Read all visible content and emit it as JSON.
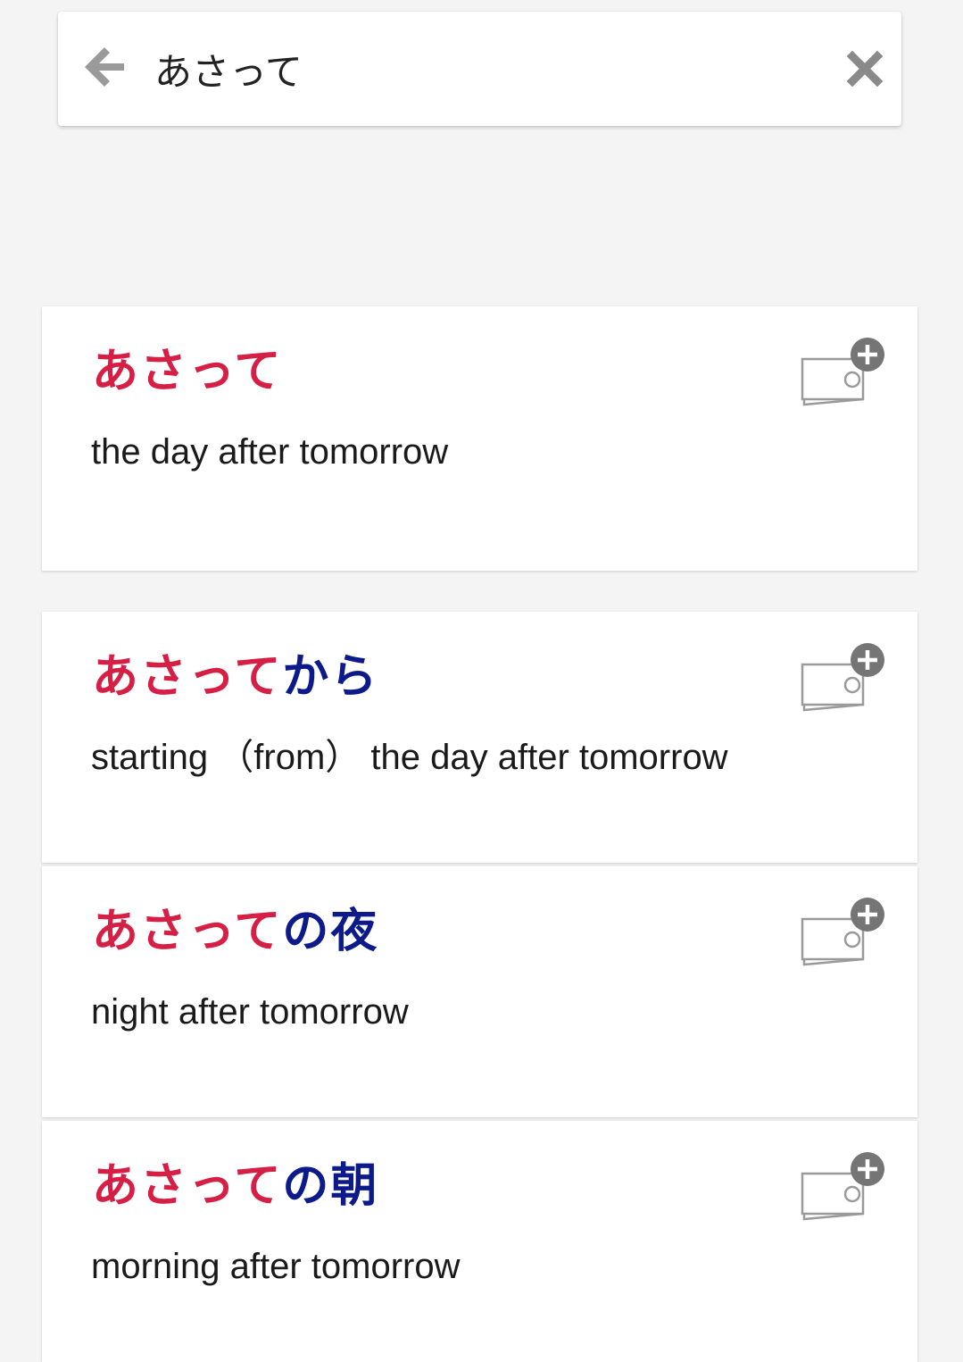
{
  "colors": {
    "highlight": "#d61f45",
    "rest": "#0d1a8a",
    "background": "#f4f4f4",
    "icon": "#9a9a9a"
  },
  "search": {
    "back_icon": "arrow-left-icon",
    "value": "あさって",
    "clear_icon": "close-icon"
  },
  "results": [
    {
      "highlight": "あさって",
      "rest": "",
      "meaning": "the day after tomorrow",
      "action_icon": "add-flashcard-icon"
    },
    {
      "highlight": "あさって",
      "rest": "から",
      "meaning": "starting （from） the day after tomorrow",
      "action_icon": "add-flashcard-icon"
    },
    {
      "highlight": "あさって",
      "rest": "の夜",
      "meaning": "night after tomorrow",
      "action_icon": "add-flashcard-icon"
    },
    {
      "highlight": "あさって",
      "rest": "の朝",
      "meaning": "morning after tomorrow",
      "action_icon": "add-flashcard-icon"
    }
  ]
}
